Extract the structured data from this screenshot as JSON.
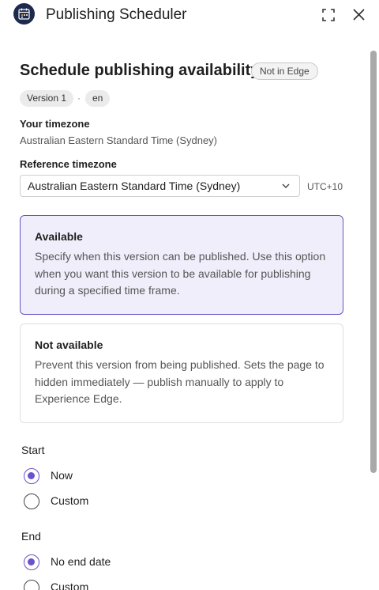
{
  "header": {
    "title": "Publishing Scheduler",
    "logo_icon": "scheduler-logo-icon",
    "expand_icon": "expand-icon",
    "close_icon": "close-icon"
  },
  "schedule": {
    "title": "Schedule publishing availability",
    "edge_status": "Not in Edge",
    "version": "Version 1",
    "separator": "·",
    "language": "en"
  },
  "timezone": {
    "your_label": "Your timezone",
    "your_value": "Australian Eastern Standard Time (Sydney)",
    "reference_label": "Reference timezone",
    "reference_value": "Australian Eastern Standard Time (Sydney)",
    "utc_offset": "UTC+10"
  },
  "options": [
    {
      "title": "Available",
      "description": "Specify when this version can be published. Use this option when you want this version to be available for publishing during a specified time frame.",
      "selected": true
    },
    {
      "title": "Not available",
      "description": "Prevent this version from being published. Sets the page to hidden immediately — publish manually to apply to Experience Edge.",
      "selected": false
    }
  ],
  "start": {
    "label": "Start",
    "options": [
      {
        "label": "Now",
        "checked": true
      },
      {
        "label": "Custom",
        "checked": false
      }
    ]
  },
  "end": {
    "label": "End",
    "options": [
      {
        "label": "No end date",
        "checked": true
      },
      {
        "label": "Custom",
        "checked": false
      }
    ]
  },
  "colors": {
    "accent": "#6b52c8",
    "selected_card_bg": "#f1eefb",
    "logo_bg": "#1d2a4d"
  }
}
